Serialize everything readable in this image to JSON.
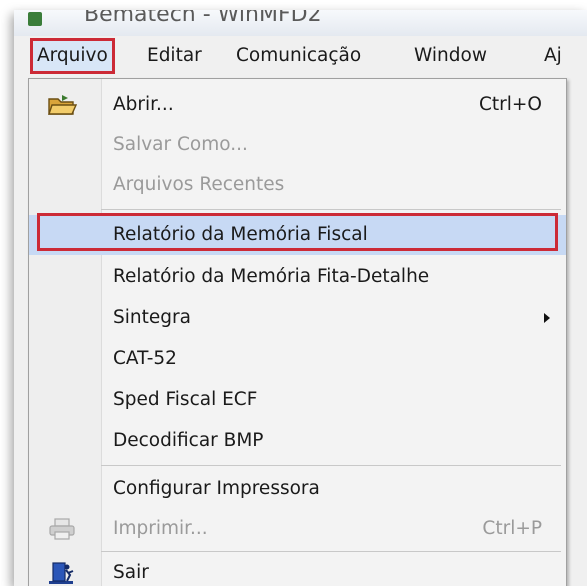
{
  "window": {
    "title": "Bematech - WinMFD2"
  },
  "menubar": {
    "items": [
      {
        "label": "Arquivo"
      },
      {
        "label": "Editar"
      },
      {
        "label": "Comunicação"
      },
      {
        "label": "Window"
      },
      {
        "label": "Aj"
      }
    ]
  },
  "menu": {
    "items": [
      {
        "label": "Abrir...",
        "shortcut": "Ctrl+O"
      },
      {
        "label": "Salvar Como..."
      },
      {
        "label": "Arquivos Recentes"
      },
      {
        "label": "Relatório da Memória Fiscal"
      },
      {
        "label": "Relatório da Memória Fita-Detalhe"
      },
      {
        "label": "Sintegra"
      },
      {
        "label": "CAT-52"
      },
      {
        "label": "Sped Fiscal ECF"
      },
      {
        "label": "Decodificar BMP"
      },
      {
        "label": "Configurar Impressora"
      },
      {
        "label": "Imprimir...",
        "shortcut": "Ctrl+P"
      },
      {
        "label": "Sair"
      }
    ],
    "icons": {
      "open": "open-folder-icon",
      "print": "printer-icon",
      "exit": "exit-door-icon"
    }
  },
  "colors": {
    "highlight_box": "#cc2a36",
    "hover_bg": "#c7d9f4",
    "menu_bg": "#f3f3f3",
    "disabled_text": "#9a9a9a"
  }
}
